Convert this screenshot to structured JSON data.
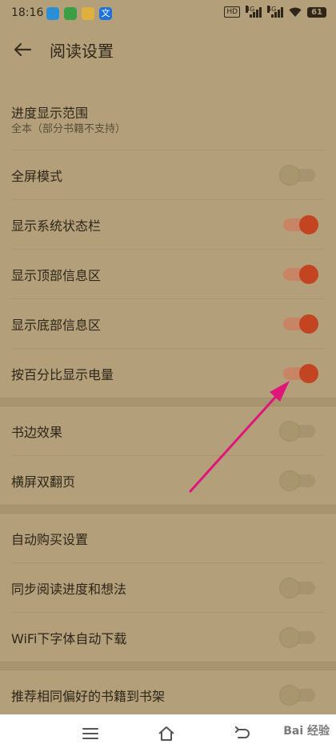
{
  "status_bar": {
    "time": "18:16",
    "hd_label": "HD",
    "signal1_label": "4G",
    "signal2_label": "4G",
    "battery": "61"
  },
  "toolbar": {
    "title": "阅读设置"
  },
  "settings": {
    "progress_range": {
      "label": "进度显示范围",
      "value": "全本（部分书籍不支持）"
    },
    "fullscreen": {
      "label": "全屏模式",
      "enabled": false
    },
    "system_status_bar": {
      "label": "显示系统状态栏",
      "enabled": true
    },
    "top_info": {
      "label": "显示顶部信息区",
      "enabled": true
    },
    "bottom_info": {
      "label": "显示底部信息区",
      "enabled": true
    },
    "battery_percent": {
      "label": "按百分比显示电量",
      "enabled": true
    },
    "page_edge": {
      "label": "书边效果",
      "enabled": false
    },
    "landscape_double": {
      "label": "横屏双翻页",
      "enabled": false
    },
    "auto_purchase": {
      "label": "自动购买设置"
    },
    "sync_progress": {
      "label": "同步阅读进度和想法",
      "enabled": false
    },
    "wifi_font": {
      "label": "WiFi下字体自动下载",
      "enabled": false
    },
    "recommend_books": {
      "label": "推荐相同偏好的书籍到书架",
      "enabled": false
    }
  },
  "colors": {
    "background": "#b3a07b",
    "toggle_on": "#c24420",
    "annotation_arrow": "#e0157a"
  },
  "icons": {
    "back": "back-arrow-icon",
    "menu": "menu-icon",
    "home": "home-icon",
    "back_nav": "back-nav-icon"
  },
  "watermark": "Bai 经验"
}
